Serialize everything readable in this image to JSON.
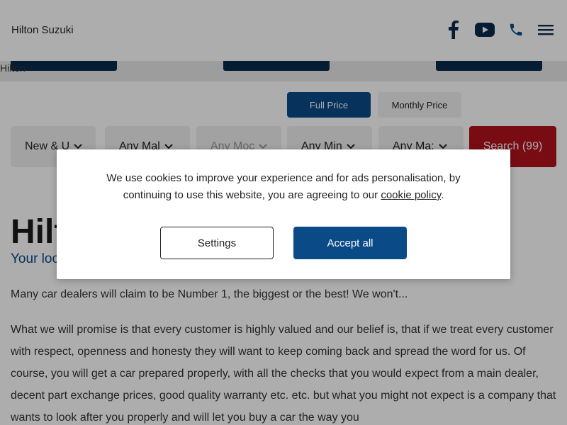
{
  "header": {
    "logo_alt": "Hilton Suzuki",
    "icons": [
      "facebook-icon",
      "youtube-icon",
      "phone-icon",
      "menu-icon"
    ]
  },
  "hero": {
    "image_alt": "Hilton"
  },
  "price_toggle": {
    "full_price": "Full Price",
    "monthly_price": "Monthly Price"
  },
  "search": {
    "condition": "New & U",
    "make": "Any Mal",
    "model": "Any Moc",
    "min_price": "Any Min",
    "max_price": "Any Ma:",
    "button": "Search (99)"
  },
  "main": {
    "title": "Hilton",
    "subtitle": "Your local car dealer since 1996",
    "para1": "Many car dealers will claim to be Number 1, the biggest or the best! We won't...",
    "para2": "What we will promise is that every customer is highly valued and our belief is, that if we treat every customer with respect, openness and honesty they will want to keep coming back and spread the word for us. Of course, you will get a car prepared properly, with all the checks that you would expect from a main dealer, decent part exchange prices, good quality warranty etc. etc. but what you might not expect is a company that wants to look after you properly and will let you buy a car the way you"
  },
  "cookie": {
    "text_before": "We use cookies to improve your experience and for ads personalisation, by continuing to use this website, you are agreeing to our ",
    "link": "cookie policy",
    "text_after": ".",
    "settings": "Settings",
    "accept": "Accept all"
  },
  "colors": {
    "brand_blue": "#0a4a86",
    "search_red": "#b3111d",
    "dark_navy": "#0a2a4a"
  }
}
